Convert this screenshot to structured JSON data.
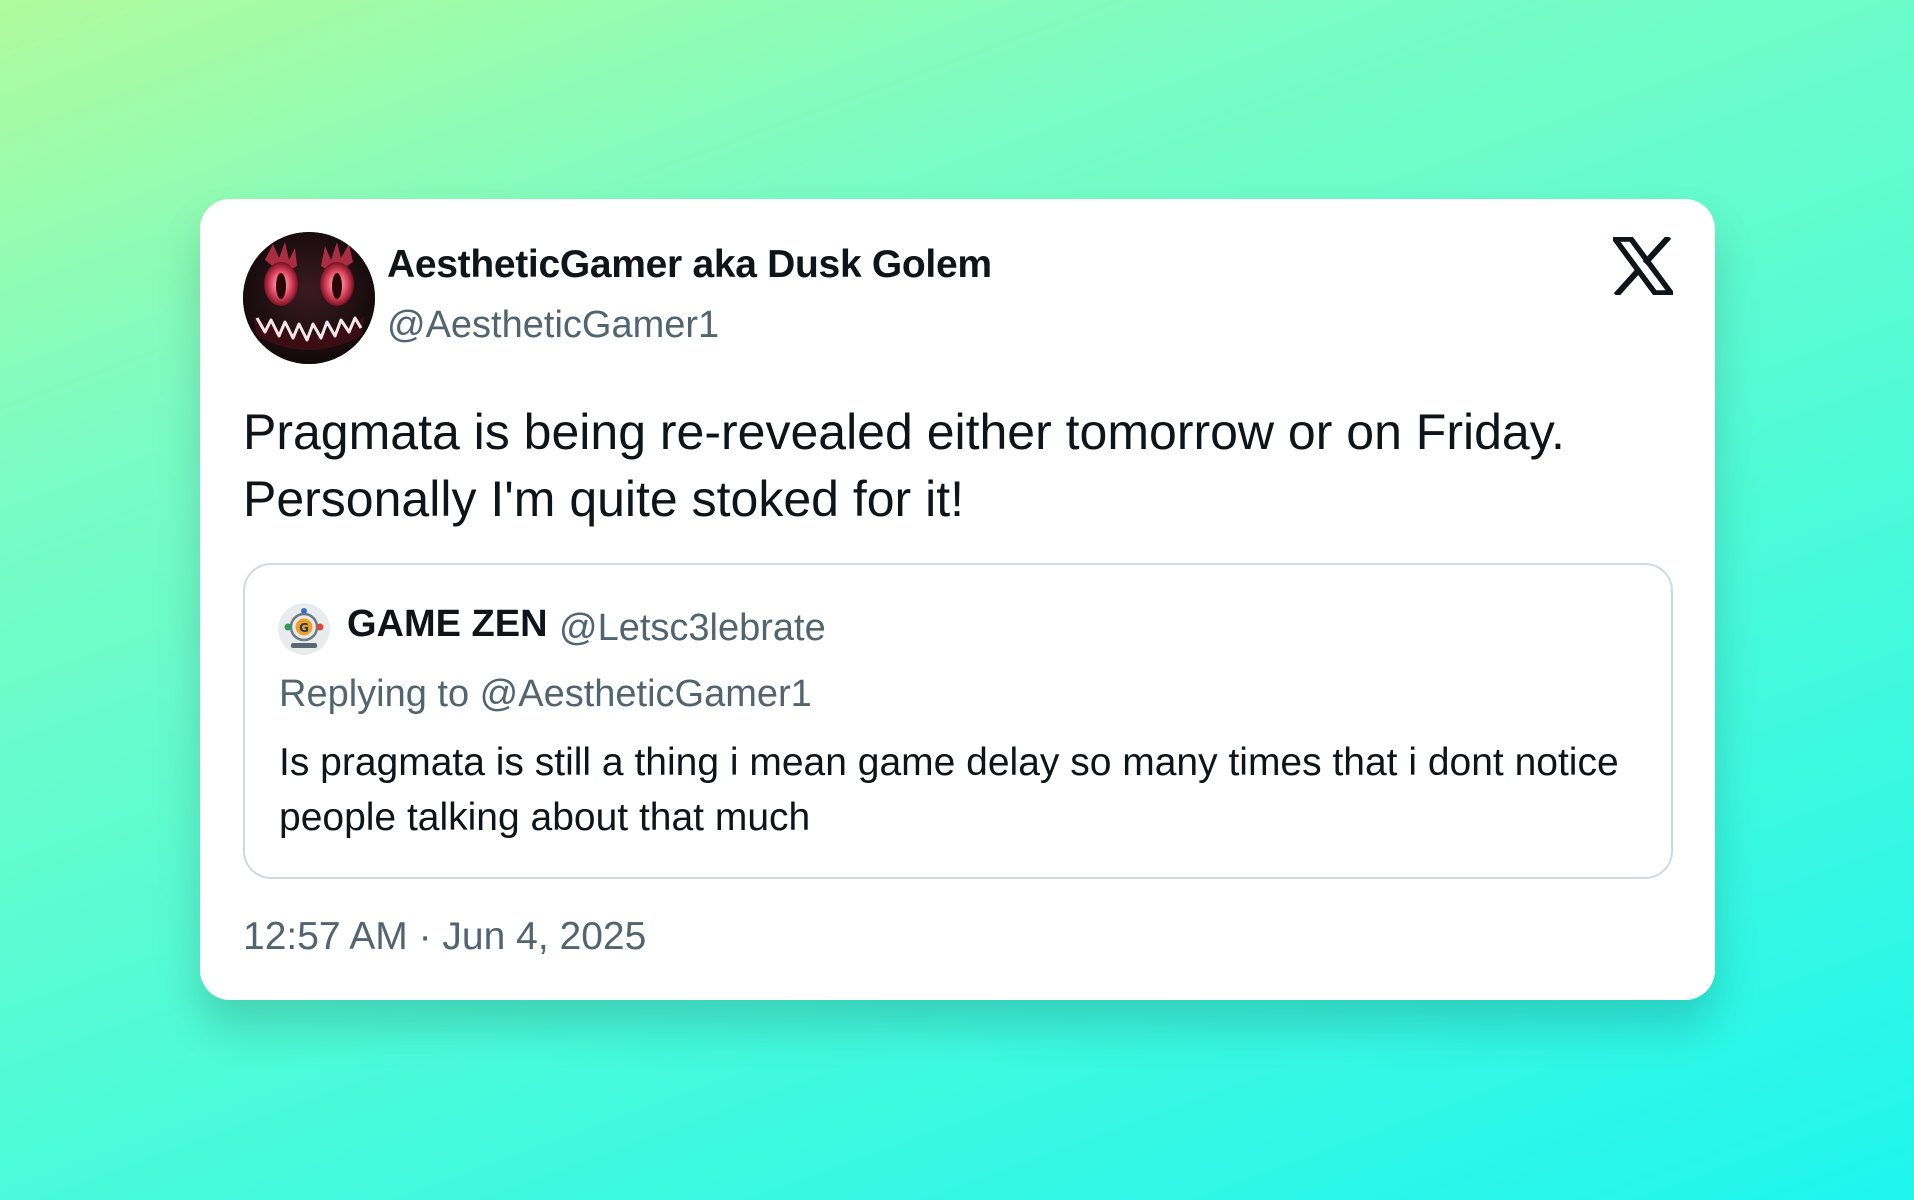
{
  "tweet": {
    "author": {
      "display_name": "AestheticGamer aka Dusk Golem",
      "handle": "@AestheticGamer1",
      "avatar_icon": "grinning-monster-avatar"
    },
    "brand_icon": "x-logo-icon",
    "text": "Pragmata is being re-revealed either tomorrow or on Friday. Personally I'm quite stoked for it!",
    "timestamp": "12:57 AM · Jun 4, 2025"
  },
  "quoted_tweet": {
    "author": {
      "display_name": "GAME ZEN",
      "handle": "@Letsc3lebrate",
      "avatar_icon": "game-zen-logo-avatar"
    },
    "reply_to": "Replying to @AestheticGamer1",
    "text": "Is pragmata is still a thing i mean game delay so many times that i dont notice people talking about that much"
  },
  "colors": {
    "primary_text": "#0f1419",
    "secondary_text": "#536471",
    "border": "#cfd9de",
    "card_bg": "#ffffff",
    "gradient_start": "#b0fb9c",
    "gradient_end": "#1ff5ee"
  }
}
